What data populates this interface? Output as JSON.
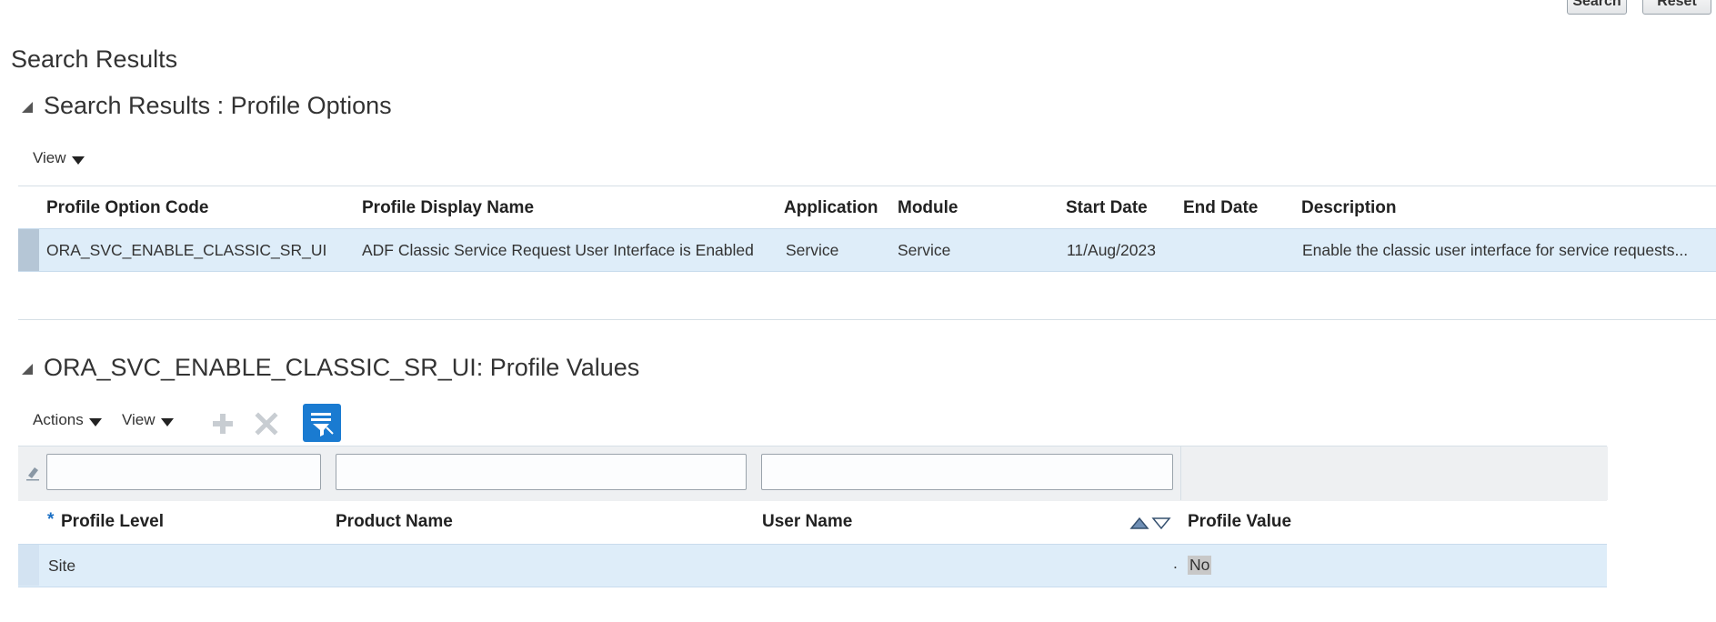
{
  "top_buttons": {
    "search": "Search",
    "reset": "Reset"
  },
  "page_title": "Search Results",
  "profile_options": {
    "title": "Search Results : Profile Options",
    "view_label": "View",
    "columns": [
      "Profile Option Code",
      "Profile Display Name",
      "Application",
      "Module",
      "Start Date",
      "End Date",
      "Description"
    ],
    "rows": [
      {
        "code": "ORA_SVC_ENABLE_CLASSIC_SR_UI",
        "display_name": "ADF Classic Service Request User Interface is Enabled",
        "application": "Service",
        "module": "Service",
        "start_date": "11/Aug/2023",
        "end_date": "",
        "description": "Enable the classic user interface for service requests..."
      }
    ]
  },
  "profile_values": {
    "title": "ORA_SVC_ENABLE_CLASSIC_SR_UI: Profile Values",
    "actions_label": "Actions",
    "view_label": "View",
    "filters": {
      "profile_level": "",
      "product_name": "",
      "user_name": ""
    },
    "required_marker": "*",
    "columns": [
      "Profile Level",
      "Product Name",
      "User Name",
      "Profile Value"
    ],
    "rows": [
      {
        "profile_level": "Site",
        "product_name": "",
        "user_name": ".",
        "profile_value": "No"
      }
    ]
  },
  "icons": {
    "disclosure": "collapse-triangle-icon",
    "add": "plus-icon",
    "delete": "x-icon",
    "query_by_example": "query-by-example-icon",
    "sort": "sort-arrows-icon",
    "clear_filter": "eraser-icon"
  },
  "colors": {
    "selected_row": "#deedf9",
    "accent": "#1a7bd1",
    "required": "#1a6fc4"
  }
}
